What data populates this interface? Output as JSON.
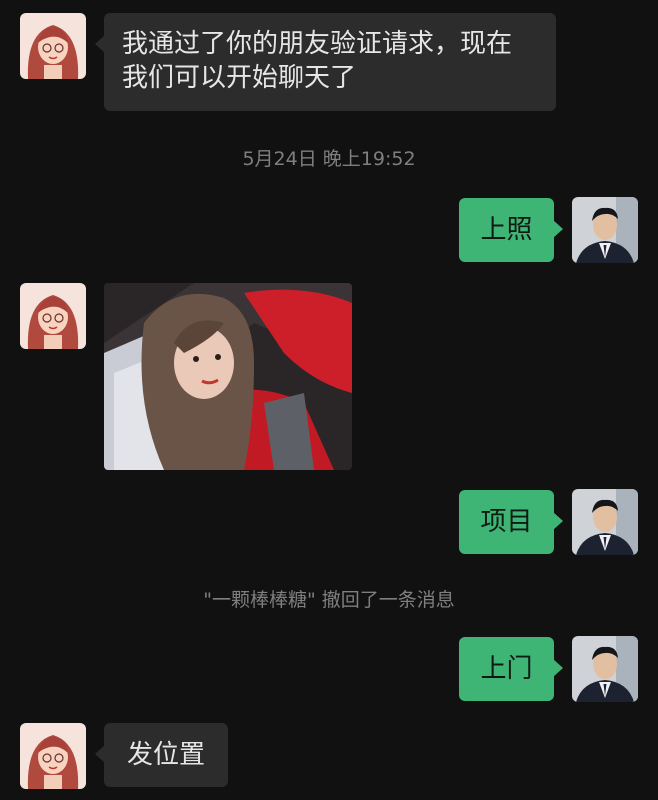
{
  "messages": {
    "m1": {
      "text_line1": "我通过了你的朋友验证请求，现在",
      "text_line2": "我们可以开始聊天了"
    },
    "timestamp": "5月24日 晚上19:52",
    "m2": {
      "text": "上照"
    },
    "m4": {
      "text": "项目"
    },
    "recall_notice": "\"一颗棒棒糖\" 撤回了一条消息",
    "m5": {
      "text": "上门"
    },
    "m6": {
      "text": "发位置"
    }
  },
  "colors": {
    "background": "#111111",
    "incoming_bubble": "#2c2c2c",
    "outgoing_bubble": "#3eb575",
    "system_text": "#7f7f7f"
  },
  "icons": {
    "contact_avatar": "girl-cartoon-avatar",
    "self_avatar": "man-suit-avatar",
    "photo": "selfie-photo"
  }
}
